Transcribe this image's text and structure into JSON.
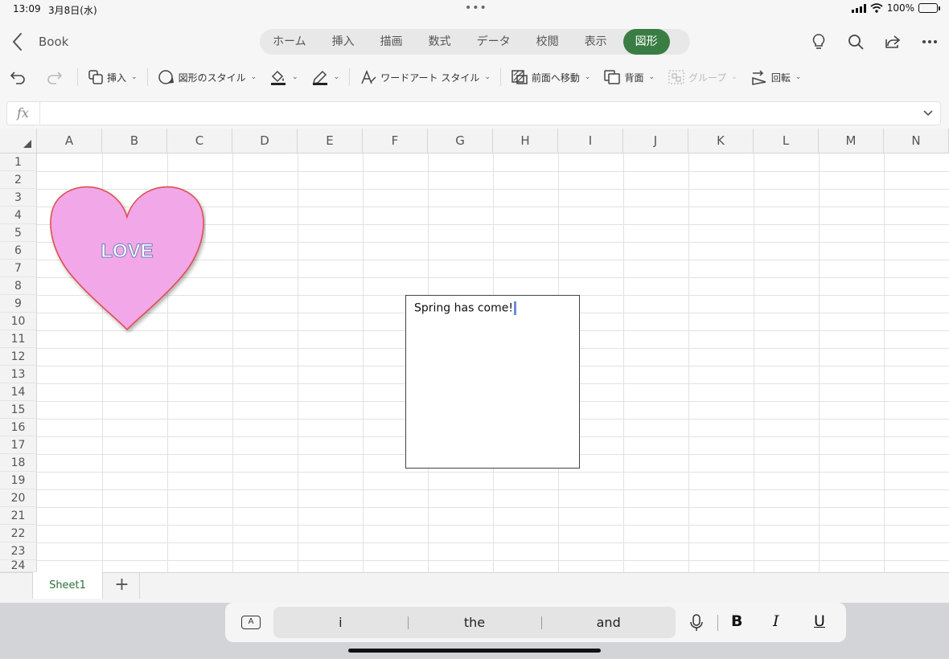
{
  "status": {
    "time": "13:09",
    "date": "3月8日(水)",
    "battery": "100%"
  },
  "title": {
    "book": "Book"
  },
  "tabs": [
    {
      "label": "ホーム"
    },
    {
      "label": "挿入"
    },
    {
      "label": "描画"
    },
    {
      "label": "数式"
    },
    {
      "label": "データ"
    },
    {
      "label": "校閲"
    },
    {
      "label": "表示"
    },
    {
      "label": "図形"
    }
  ],
  "toolbar": {
    "insert": "挿入",
    "shape_style": "図形のスタイル",
    "wordart_style": "ワードアート スタイル",
    "bring_forward": "前面へ移動",
    "send_backward": "背面",
    "group": "グループ",
    "rotate": "回転"
  },
  "formula": {
    "fx": "fx",
    "value": ""
  },
  "columns": [
    "A",
    "B",
    "C",
    "D",
    "E",
    "F",
    "G",
    "H",
    "I",
    "J",
    "K",
    "L",
    "M",
    "N"
  ],
  "rows": [
    "1",
    "2",
    "3",
    "4",
    "5",
    "6",
    "7",
    "8",
    "9",
    "10",
    "11",
    "12",
    "13",
    "14",
    "15",
    "16",
    "17",
    "18",
    "19",
    "20",
    "21",
    "22",
    "23",
    "24"
  ],
  "shapes": {
    "heart_text": "LOVE",
    "heart_fill": "#f1a7e8",
    "heart_stroke": "#e04a4a",
    "textbox_text": "Spring has come!"
  },
  "sheets": {
    "active": "Sheet1",
    "add": "+"
  },
  "keyboard": {
    "suggestions": [
      "i",
      "the",
      "and"
    ],
    "a_label": "A",
    "bold": "B",
    "italic": "I",
    "underline": "U"
  },
  "colors": {
    "accent": "#3a7d44"
  }
}
